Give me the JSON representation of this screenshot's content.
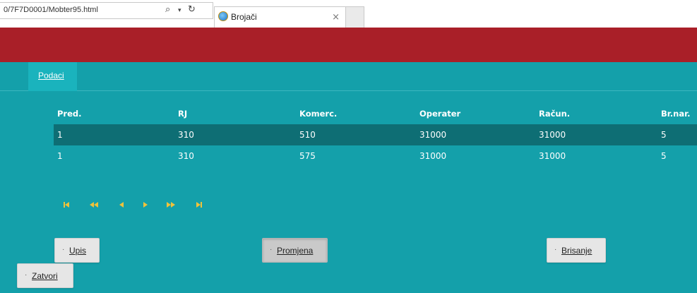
{
  "browser": {
    "address": "0/7F7D0001/Mobter95.html",
    "tab_title": "Brojači",
    "tab_close": "×"
  },
  "page": {
    "tab_label": "Podaci",
    "columns": [
      "Pred.",
      "RJ",
      "Komerc.",
      "Operater",
      "Račun.",
      "Br.nar."
    ],
    "rows": [
      [
        "1",
        "310",
        "510",
        "31000",
        "31000",
        "5"
      ],
      [
        "1",
        "310",
        "575",
        "31000",
        "31000",
        "5"
      ]
    ],
    "selected_row": 0,
    "pager_icons": [
      "first-page-icon",
      "prev-block-icon",
      "prev-page-icon",
      "next-page-icon",
      "next-block-icon",
      "last-page-icon"
    ],
    "buttons": {
      "upis": "Upis",
      "promjena": "Promjena",
      "brisanje": "Brisanje",
      "zatvori": "Zatvori"
    },
    "button_dot": "·"
  },
  "colors": {
    "header_red": "#a91f28",
    "teal": "#14a0aa",
    "selected_row": "#0e6e74",
    "pager_icon": "#f0c23a"
  }
}
